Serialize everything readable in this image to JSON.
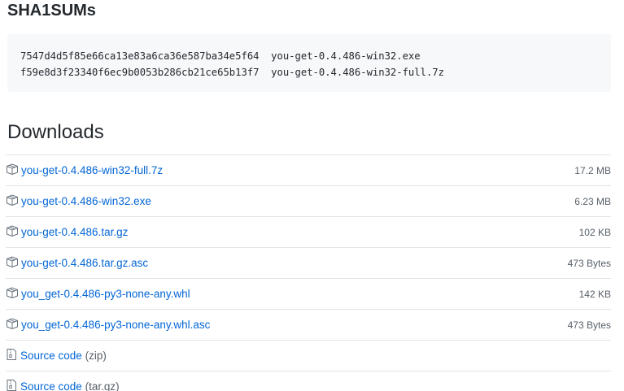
{
  "sha_section": {
    "title": "SHA1SUMs",
    "lines": [
      "7547d4d5f85e66ca13e83a6ca36e587ba34e5f64  you-get-0.4.486-win32.exe",
      "f59e8d3f23340f6ec9b0053b286cb21ce65b13f7  you-get-0.4.486-win32-full.7z"
    ]
  },
  "downloads": {
    "title": "Downloads",
    "assets": [
      {
        "name": "you-get-0.4.486-win32-full.7z",
        "size": "17.2 MB",
        "icon": "package-icon"
      },
      {
        "name": "you-get-0.4.486-win32.exe",
        "size": "6.23 MB",
        "icon": "package-icon"
      },
      {
        "name": "you-get-0.4.486.tar.gz",
        "size": "102 KB",
        "icon": "package-icon"
      },
      {
        "name": "you-get-0.4.486.tar.gz.asc",
        "size": "473 Bytes",
        "icon": "package-icon"
      },
      {
        "name": "you_get-0.4.486-py3-none-any.whl",
        "size": "142 KB",
        "icon": "package-icon"
      },
      {
        "name": "you_get-0.4.486-py3-none-any.whl.asc",
        "size": "473 Bytes",
        "icon": "package-icon"
      }
    ],
    "sources": [
      {
        "label": "Source code",
        "ext": "(zip)",
        "icon": "file-zip-icon"
      },
      {
        "label": "Source code",
        "ext": "(tar.gz)",
        "icon": "file-zip-icon"
      }
    ]
  },
  "colors": {
    "link": "#0366d6",
    "muted": "#586069",
    "border": "#e1e4e8",
    "code_bg": "#f6f8fa"
  }
}
